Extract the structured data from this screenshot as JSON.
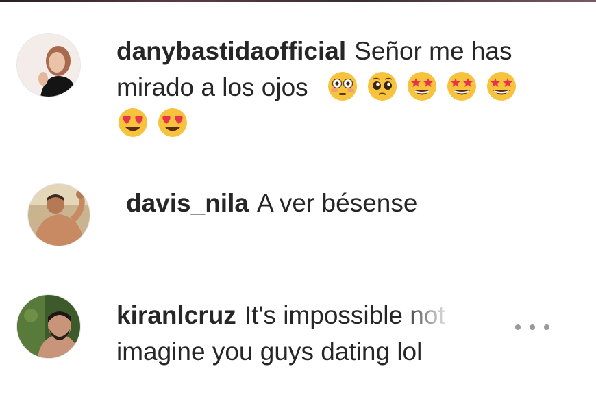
{
  "comments": [
    {
      "username": "danybastidaofficial",
      "text_line1": "Señor me has",
      "text_line2": "mirado a los ojos",
      "emojis_line2": [
        "flushed-face",
        "pleading-face",
        "star-struck",
        "star-struck",
        "star-struck"
      ],
      "emojis_line3": [
        "heart-eyes",
        "heart-eyes"
      ]
    },
    {
      "username": "davis_nila",
      "text": "A ver bésense"
    },
    {
      "username": "kiranlcruz",
      "text_line1": "It's impossible not",
      "text_line2": "imagine you guys dating lol"
    }
  ],
  "more_button_icon": "more-horizontal-icon",
  "colors": {
    "text": "#262626",
    "dots": "#9a9a9a",
    "emoji_yellow": "#f7c23c",
    "heart_red": "#e8344a"
  }
}
